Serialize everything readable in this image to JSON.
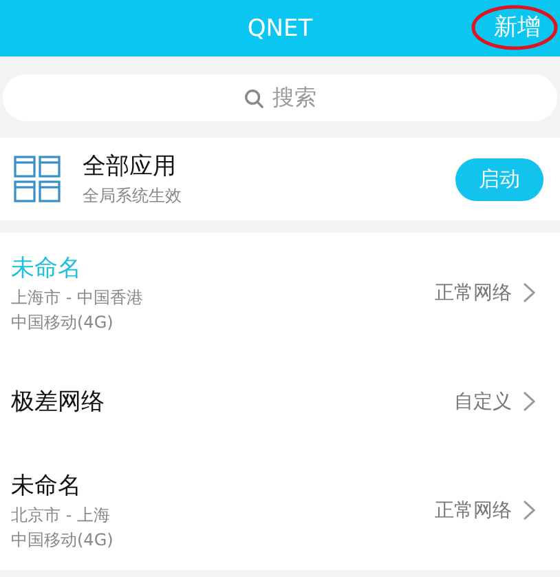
{
  "header": {
    "title": "QNET",
    "action": "新增"
  },
  "search": {
    "placeholder": "搜索"
  },
  "all_apps": {
    "title": "全部应用",
    "subtitle": "全局系统生效",
    "button": "启动"
  },
  "profiles": [
    {
      "name": "未命名",
      "selected": true,
      "route": "上海市 - 中国香港",
      "carrier": "中国移动(4G)",
      "mode": "正常网络"
    },
    {
      "name": "极差网络",
      "selected": false,
      "mode": "自定义"
    },
    {
      "name": "未命名",
      "selected": false,
      "route": "北京市 - 上海",
      "carrier": "中国移动(4G)",
      "mode": "正常网络"
    }
  ]
}
